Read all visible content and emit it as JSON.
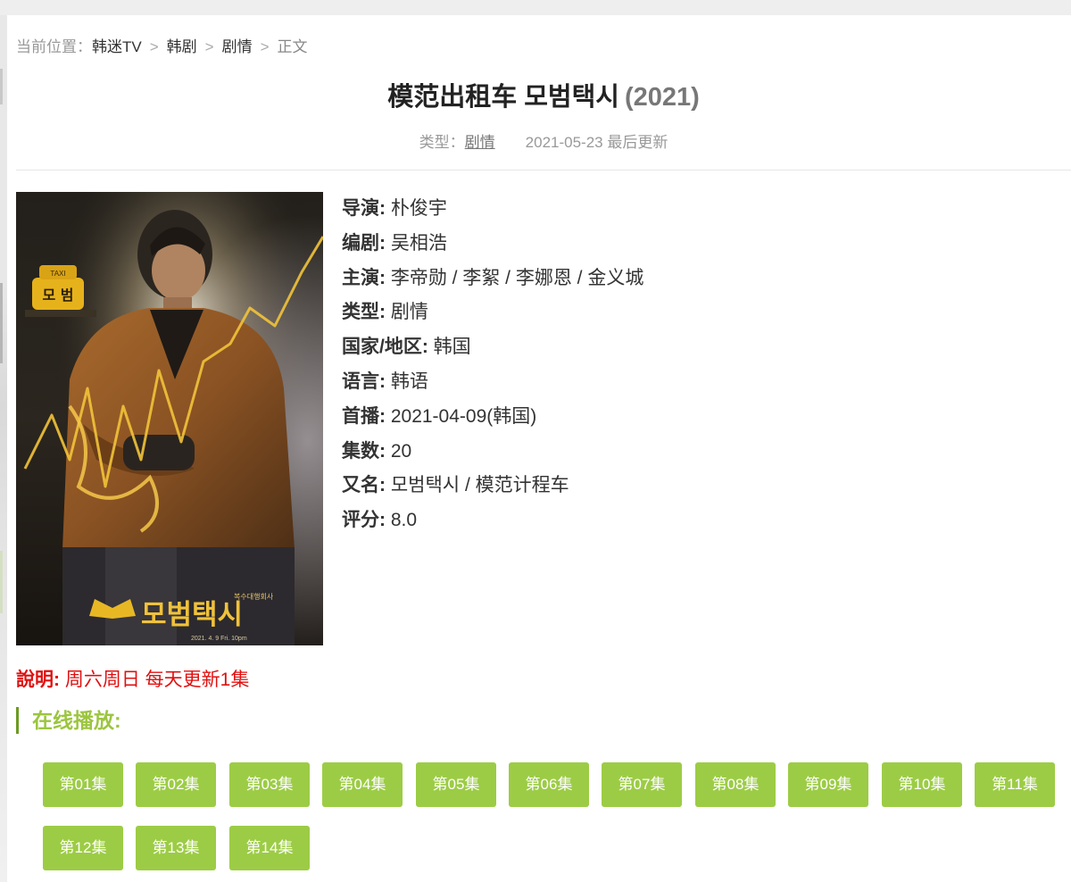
{
  "breadcrumb": {
    "prefix": "当前位置：",
    "items": [
      "韩迷TV",
      "韩剧",
      "剧情"
    ],
    "separator": ">",
    "current": "正文"
  },
  "title": {
    "main": "模范出租车 모범택시",
    "year": "(2021)"
  },
  "meta": {
    "genre_label": "类型：",
    "genre_value": "剧情",
    "updated": "2021-05-23 最后更新"
  },
  "poster": {
    "taxi_sign_top": "TAXI",
    "taxi_sign": "모 범",
    "logo_text": "모범택시",
    "tagline": "복수대행회사",
    "date_text": "2021. 4. 9 Fri. 10pm"
  },
  "info": [
    {
      "label": "导演:",
      "value": "朴俊宇"
    },
    {
      "label": "编剧:",
      "value": "吴相浩"
    },
    {
      "label": "主演:",
      "value": "李帝勋 / 李絮 / 李娜恩 / 金义城"
    },
    {
      "label": "类型:",
      "value": "剧情"
    },
    {
      "label": "国家/地区:",
      "value": "韩国"
    },
    {
      "label": "语言:",
      "value": "韩语"
    },
    {
      "label": "首播:",
      "value": "2021-04-09(韩国)"
    },
    {
      "label": "集数:",
      "value": "20"
    },
    {
      "label": "又名:",
      "value": "모범택시 / 模范计程车"
    },
    {
      "label": "评分:",
      "value": "8.0"
    }
  ],
  "notice": {
    "label": "說明:",
    "text": "周六周日 每天更新1集"
  },
  "section": {
    "title": "在线播放:"
  },
  "episodes": [
    "第01集",
    "第02集",
    "第03集",
    "第04集",
    "第05集",
    "第06集",
    "第07集",
    "第08集",
    "第09集",
    "第10集",
    "第11集",
    "第12集",
    "第13集",
    "第14集"
  ],
  "colors": {
    "accent_green": "#9ccc45",
    "section_green": "#9cc53f",
    "notice_red": "#e01010"
  }
}
